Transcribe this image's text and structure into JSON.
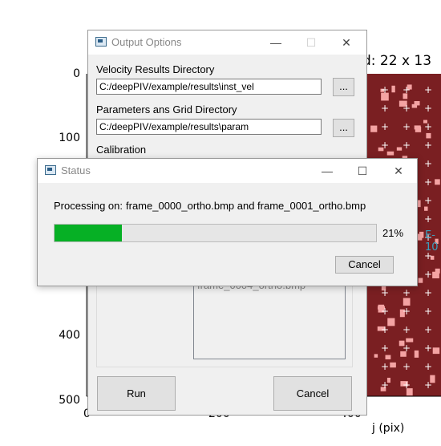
{
  "plot": {
    "title_fragment": "d: 22 x 13",
    "y_ticks": [
      "0",
      "100",
      "400",
      "500"
    ],
    "x_ticks": [
      "0",
      "200",
      "400"
    ],
    "xlabel": "j (pix)",
    "annotation_fragment": "E-10"
  },
  "output_options": {
    "title": "Output Options",
    "minimize_glyph": "—",
    "maximize_glyph": "☐",
    "close_glyph": "✕",
    "velocity_label": "Velocity Results Directory",
    "velocity_value": "C:/deepPIV/example/results\\inst_vel",
    "parameters_label": "Parameters ans Grid Directory",
    "parameters_value": "C:/deepPIV/example/results\\param",
    "calibration_label": "Calibration",
    "browse_label": "...",
    "file_list_partial": "frame_0004_ortho.bmp",
    "run_label": "Run",
    "cancel_label": "Cancel"
  },
  "status": {
    "title": "Status",
    "minimize_glyph": "—",
    "maximize_glyph": "☐",
    "close_glyph": "✕",
    "processing_label": "Processing on:",
    "processing_value": "frame_0000_ortho.bmp and frame_0001_ortho.bmp",
    "progress": 0.21,
    "progress_text": "21%",
    "cancel_label": "Cancel",
    "progress_color": "#06b025"
  }
}
